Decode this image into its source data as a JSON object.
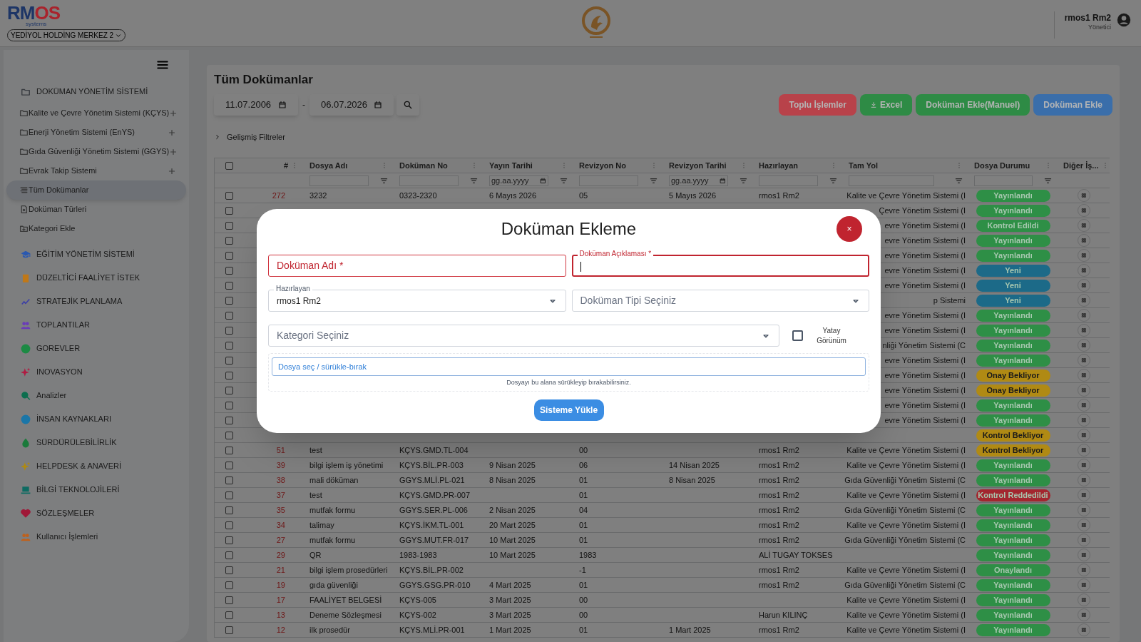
{
  "header": {
    "logo": "RMOS",
    "logo_sub": "systems",
    "company": "YEDİYOL HOLDİNG MERKEZ 2",
    "user": {
      "name": "rmos1 Rm2",
      "role": "Yönetici"
    }
  },
  "sidebar": {
    "items": [
      {
        "label": "DOKÜMAN YÖNETİM SİSTEMİ",
        "color": "#3a3d42",
        "selected": false,
        "children": [
          {
            "label": "Kalite ve Çevre Yönetim Sistemi (KÇYS)",
            "kind": "folder",
            "selected": false
          },
          {
            "label": "Enerji Yönetim Sistemi (EnYS)",
            "kind": "folder",
            "selected": false
          },
          {
            "label": "Gıda Güvenliği Yönetim Sistemi (GGYS)",
            "kind": "folder",
            "selected": false
          },
          {
            "label": "Evrak Takip Sistemi",
            "kind": "folder",
            "selected": false
          },
          {
            "label": "Tüm Dokümanlar",
            "kind": "page",
            "selected": true
          },
          {
            "label": "Doküman Türleri",
            "kind": "page",
            "selected": false
          },
          {
            "label": "Kategori Ekle",
            "kind": "page",
            "selected": false
          }
        ]
      },
      {
        "label": "EĞİTİM YÖNETİM SİSTEMİ",
        "color": "#2a58b0",
        "selected": false
      },
      {
        "label": "DÜZELTİCİ FAALİYET İSTEK",
        "color": "#c07818",
        "selected": false
      },
      {
        "label": "STRATEJİK PLANLAMA",
        "color": "#3b3ea8",
        "selected": false
      },
      {
        "label": "TOPLANTILAR",
        "color": "#6a3cb8",
        "selected": false
      },
      {
        "label": "GOREVLER",
        "color": "#1c8a44",
        "selected": false
      },
      {
        "label": "INOVASYON",
        "color": "#b01c42",
        "selected": false
      },
      {
        "label": "Analizler",
        "color": "#0c6e4e",
        "selected": false
      },
      {
        "label": "İNSAN KAYNAKLARI",
        "color": "#1a76a8",
        "selected": false
      },
      {
        "label": "SÜRDÜRÜLEBİLİRLİK",
        "color": "#1a7a3a",
        "selected": false
      },
      {
        "label": "HELPDESK & ANAVERİ",
        "color": "#b08a10",
        "selected": false
      },
      {
        "label": "BİLGİ TEKNOLOJİLERİ",
        "color": "#0e6b62",
        "selected": false
      },
      {
        "label": "SÖZLEŞMELER",
        "color": "#a01838",
        "selected": false
      },
      {
        "label": "Kullanıcı İşlemleri",
        "color": "#c0601a",
        "selected": false
      }
    ]
  },
  "page": {
    "title": "Tüm Dokümanlar",
    "date_from": "11.07.2006",
    "date_separator": "-",
    "date_to": "06.07.2026",
    "buttons": [
      {
        "label": "Toplu İşlemler",
        "color": "#b8424a"
      },
      {
        "label": "Excel",
        "color": "#2e8b45"
      },
      {
        "label": "Doküman Ekle(Manuel)",
        "color": "#2e8b45"
      },
      {
        "label": "Doküman Ekle",
        "color": "#3a6eaa"
      }
    ],
    "filters_toggle": "Gelişmiş Filtreler"
  },
  "table": {
    "select_all_checked": false,
    "columns": [
      {
        "label": "#",
        "kind": "none"
      },
      {
        "label": "Dosya Adı",
        "kind": "text"
      },
      {
        "label": "Doküman No",
        "kind": "text"
      },
      {
        "label": "Yayın Tarihi",
        "kind": "date",
        "placeholder": "gg.aa.yyyy"
      },
      {
        "label": "Revizyon No",
        "kind": "text"
      },
      {
        "label": "Revizyon Tarihi",
        "kind": "date",
        "placeholder": "gg.aa.yyyy"
      },
      {
        "label": "Hazırlayan",
        "kind": "text"
      },
      {
        "label": "Tam Yol",
        "kind": "text"
      },
      {
        "label": "Dosya Durumu",
        "kind": "text"
      },
      {
        "label": "Diğer İş...",
        "kind": "none"
      }
    ],
    "rows": [
      {
        "selected": false,
        "number": "272",
        "file_name": "3232",
        "doc_no": "0323-2320",
        "publish_date": "6 Mayıs 2026",
        "revision_no": "05",
        "revision_date": "5 Mayıs 2026",
        "prepared_by": "rmos1 Rm2",
        "path": "Kalite ve Çevre Yönetim Sistemi (I",
        "status": {
          "label": "Yayınlandı",
          "color": "#2e8f46"
        }
      },
      {
        "selected": false,
        "path": "Çevre Yönetim Sistemi (I",
        "status": {
          "label": "Yayınlandı",
          "color": "#2e8f46"
        }
      },
      {
        "selected": false,
        "path": "evre Yönetim Sistemi (I",
        "status": {
          "label": "Kontrol Edildi",
          "color": "#2e8f46"
        }
      },
      {
        "selected": false,
        "path": "evre Yönetim Sistemi (I",
        "status": {
          "label": "Yayınlandı",
          "color": "#2e8f46"
        }
      },
      {
        "selected": false,
        "path": "evre Yönetim Sistemi (I",
        "status": {
          "label": "Yayınlandı",
          "color": "#2e8f46"
        }
      },
      {
        "selected": false,
        "path": "evre Yönetim Sistemi (I",
        "status": {
          "label": "Yeni",
          "color": "#1c6a88"
        }
      },
      {
        "selected": false,
        "path": "evre Yönetim Sistemi (I",
        "status": {
          "label": "Yeni",
          "color": "#1c6a88"
        }
      },
      {
        "selected": false,
        "path": "p Sistemi",
        "status": {
          "label": "Yeni",
          "color": "#1c6a88"
        }
      },
      {
        "selected": false,
        "path": "evre Yönetim Sistemi (I",
        "status": {
          "label": "Yayınlandı",
          "color": "#2e8f46"
        }
      },
      {
        "selected": false,
        "path": "evre Yönetim Sistemi (I",
        "status": {
          "label": "Yayınlandı",
          "color": "#2e8f46"
        }
      },
      {
        "selected": false,
        "path": "nliği Yönetim Sistemi (C",
        "status": {
          "label": "Yayınlandı",
          "color": "#2e8f46"
        }
      },
      {
        "selected": false,
        "path": "evre Yönetim Sistemi (I",
        "status": {
          "label": "Yayınlandı",
          "color": "#2e8f46"
        }
      },
      {
        "selected": false,
        "path": "evre Yönetim Sistemi (I",
        "status": {
          "label": "Onay Bekliyor",
          "color": "#b08a14"
        }
      },
      {
        "selected": false,
        "path": "evre Yönetim Sistemi (I",
        "status": {
          "label": "Onay Bekliyor",
          "color": "#b08a14"
        }
      },
      {
        "selected": false,
        "path": "evre Yönetim Sistemi (I",
        "status": {
          "label": "Yayınlandı",
          "color": "#2e8f46"
        }
      },
      {
        "selected": false,
        "path": "evre Yönetim Sistemi (I",
        "status": {
          "label": "Yayınlandı",
          "color": "#2e8f46"
        }
      },
      {
        "selected": false,
        "status": {
          "label": "Kontrol Bekliyor",
          "color": "#b08a14"
        }
      },
      {
        "selected": false,
        "number": "51",
        "file_name": "test",
        "doc_no": "KÇYS.GMD.TL-004",
        "revision_no": "00",
        "prepared_by": "rmos1 Rm2",
        "path": "Kalite ve Çevre Yönetim Sistemi (I",
        "status": {
          "label": "Kontrol Bekliyor",
          "color": "#b08a14"
        }
      },
      {
        "selected": false,
        "number": "39",
        "file_name": "bilgi işlem iş yönetimi",
        "doc_no": "KÇYS.BİL.PR-003",
        "publish_date": "9 Nisan 2025",
        "revision_no": "06",
        "revision_date": "14 Nisan 2025",
        "prepared_by": "rmos1 Rm2",
        "path": "Kalite ve Çevre Yönetim Sistemi (I",
        "status": {
          "label": "Yayınlandı",
          "color": "#2e8f46"
        }
      },
      {
        "selected": false,
        "number": "38",
        "file_name": "mali döküman",
        "doc_no": "GGYS.MLİ.PL-021",
        "publish_date": "8 Nisan 2025",
        "revision_no": "01",
        "revision_date": "8 Nisan 2025",
        "prepared_by": "rmos1 Rm2",
        "path": "Gıda Güvenliği Yönetim Sistemi (C",
        "status": {
          "label": "Yayınlandı",
          "color": "#2e8f46"
        }
      },
      {
        "selected": false,
        "number": "37",
        "file_name": "test",
        "doc_no": "KÇYS.GMD.PR-007",
        "revision_no": "01",
        "prepared_by": "rmos1 Rm2",
        "path": "Kalite ve Çevre Yönetim Sistemi (I",
        "status": {
          "label": "Kontrol Reddedildi",
          "color": "#a3262f"
        }
      },
      {
        "selected": false,
        "number": "35",
        "file_name": "mutfak formu",
        "doc_no": "GGYS.SER.PL-006",
        "publish_date": "2 Nisan 2025",
        "revision_no": "04",
        "prepared_by": "rmos1 Rm2",
        "path": "Gıda Güvenliği Yönetim Sistemi (C",
        "status": {
          "label": "Yayınlandı",
          "color": "#2e8f46"
        }
      },
      {
        "selected": false,
        "number": "34",
        "file_name": "talimay",
        "doc_no": "KÇYS.İKM.TL-001",
        "publish_date": "20 Mart 2025",
        "revision_no": "01",
        "prepared_by": "rmos1 Rm2",
        "path": "Kalite ve Çevre Yönetim Sistemi (I",
        "status": {
          "label": "Yayınlandı",
          "color": "#2e8f46"
        }
      },
      {
        "selected": false,
        "number": "27",
        "file_name": "mutfak formu",
        "doc_no": "GGYS.MUT.FR-017",
        "publish_date": "10 Mart 2025",
        "revision_no": "01",
        "prepared_by": "rmos1 Rm2",
        "path": "Gıda Güvenliği Yönetim Sistemi (C",
        "status": {
          "label": "Yayınlandı",
          "color": "#2e8f46"
        }
      },
      {
        "selected": false,
        "number": "29",
        "file_name": "QR",
        "doc_no": "1983-1983",
        "publish_date": "10 Mart 2025",
        "revision_no": "1983",
        "prepared_by": "ALİ TUGAY TOKSES",
        "status": {
          "label": "Yayınlandı",
          "color": "#2e8f46"
        }
      },
      {
        "selected": false,
        "number": "21",
        "file_name": "bilgi işlem prosedürleri",
        "doc_no": "KÇYS.BİL.PR-002",
        "revision_no": "-1",
        "prepared_by": "rmos1 Rm2",
        "path": "Kalite ve Çevre Yönetim Sistemi (I",
        "status": {
          "label": "Onaylandı",
          "color": "#2e8f46"
        }
      },
      {
        "selected": false,
        "number": "19",
        "file_name": "gıda güvenliği",
        "doc_no": "GGYS.GSG.PR-010",
        "publish_date": "4 Mart 2025",
        "revision_no": "01",
        "prepared_by": "rmos1 Rm2",
        "path": "Gıda Güvenliği Yönetim Sistemi (C",
        "status": {
          "label": "Yayınlandı",
          "color": "#2e8f46"
        }
      },
      {
        "selected": false,
        "number": "17",
        "file_name": "FAALİYET BELGESİ",
        "doc_no": "KÇYS-005",
        "publish_date": "3 Mart 2025",
        "revision_no": "00",
        "path": "Kalite ve Çevre Yönetim Sistemi (I",
        "status": {
          "label": "Yayınlandı",
          "color": "#2e8f46"
        }
      },
      {
        "selected": false,
        "number": "13",
        "file_name": "Deneme Sözleşmesi",
        "doc_no": "KÇYS-002",
        "publish_date": "3 Mart 2025",
        "revision_no": "00",
        "prepared_by": "Harun KILINÇ",
        "path": "Kalite ve Çevre Yönetim Sistemi (I",
        "status": {
          "label": "Yayınlandı",
          "color": "#2e8f46"
        }
      },
      {
        "selected": false,
        "number": "12",
        "file_name": "ilk prosedür",
        "doc_no": "KÇYS.MLİ.PR-001",
        "publish_date": "1 Mart 2025",
        "revision_no": "01",
        "revision_date": "1 Mart 2025",
        "prepared_by": "rmos1 Rm2",
        "path": "Kalite ve Çevre Yönetim Sistemi (I",
        "status": {
          "label": "Yayınlandı",
          "color": "#2e8f46"
        }
      }
    ]
  },
  "dialog": {
    "title": "Doküman Ekleme",
    "close": "×",
    "fields": [
      {
        "kind": "text",
        "placeholder": "Doküman Adı *",
        "error": true,
        "focused": false
      },
      {
        "kind": "text",
        "label": "Doküman Açıklaması *",
        "error": true,
        "focused": true
      },
      {
        "kind": "select",
        "label": "Hazırlayan",
        "value": "rmos1 Rm2",
        "error": false,
        "focused": false
      },
      {
        "kind": "select",
        "placeholder": "Doküman Tipi Seçiniz",
        "error": false,
        "focused": false
      },
      {
        "kind": "select",
        "placeholder": "Kategori Seçiniz",
        "error": false,
        "focused": false
      },
      {
        "kind": "checkbox",
        "label": "Yatay Görünüm",
        "checked": false
      }
    ],
    "upload": {
      "button": "Dosya seç / sürükle-bırak",
      "hint": "Dosyayı bu alana sürükleyip bırakabilirsiniz."
    },
    "submit": "Sisteme Yükle"
  }
}
